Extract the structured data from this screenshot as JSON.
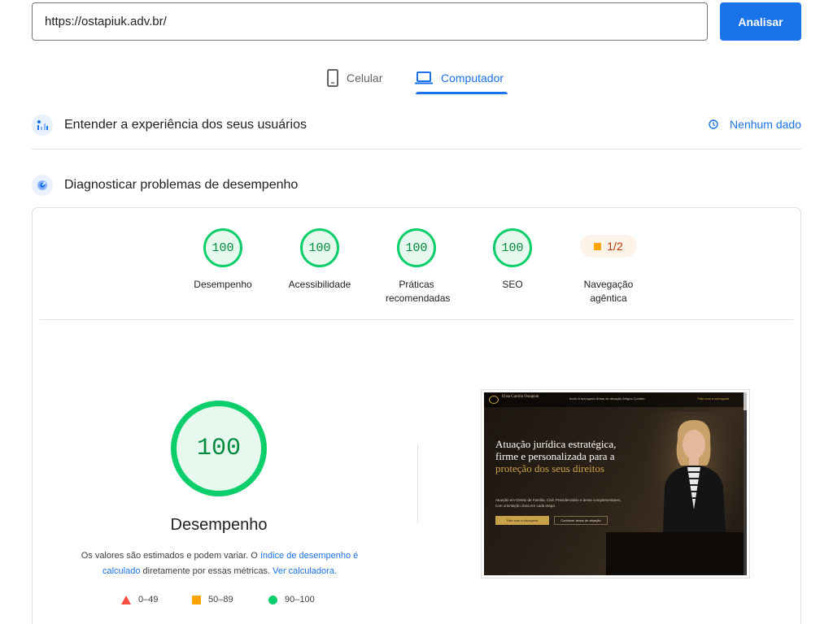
{
  "search": {
    "url_value": "https://ostapiuk.adv.br/",
    "analyze_label": "Analisar"
  },
  "device_tabs": {
    "mobile_label": "Celular",
    "desktop_label": "Computador",
    "active": "desktop"
  },
  "ux_section": {
    "title": "Entender a experiência dos seus usuários",
    "status": "Nenhum dado"
  },
  "diag_section": {
    "title": "Diagnosticar problemas de desempenho"
  },
  "scores": [
    {
      "value": "100",
      "label": "Desempenho"
    },
    {
      "value": "100",
      "label": "Acessibilidade"
    },
    {
      "value": "100",
      "label": "Práticas recomendadas"
    },
    {
      "value": "100",
      "label": "SEO"
    }
  ],
  "agentic": {
    "value": "1/2",
    "label": "Navegação agêntica"
  },
  "performance": {
    "score": "100",
    "label": "Desempenho",
    "note_prefix": "Os valores são estimados e podem variar. O ",
    "note_link1": "índice de desempenho é calculado",
    "note_middle": " diretamente por essas métricas. ",
    "note_link2": "Ver calculadora."
  },
  "legend": [
    {
      "range": "0–49",
      "shape": "triangle",
      "color": "#ff4e42"
    },
    {
      "range": "50–89",
      "shape": "square",
      "color": "#ffa400"
    },
    {
      "range": "90–100",
      "shape": "circle",
      "color": "#0cce6b"
    }
  ],
  "thumbnail": {
    "logo_text": "Elisa Carolin Ostapiuk",
    "menu_text": "Início   A advogada   Áreas de atuação   Artigos   Contato",
    "top_cta": "Fale com a advogada",
    "headline_1": "Atuação jurídica estratégica, firme e personalizada para a ",
    "headline_gold": "proteção dos seus direitos",
    "subtext": "Atuação em Direito de Família, Civil, Previdenciário e áreas complementares, com orientação clara em cada etapa.",
    "btn_primary": "Fale com a advogada",
    "btn_secondary": "Conhecer áreas de atuação"
  },
  "colors": {
    "accent": "#1a73e8",
    "pass": "#0cce6b",
    "average": "#ffa400",
    "fail": "#ff4e42"
  }
}
